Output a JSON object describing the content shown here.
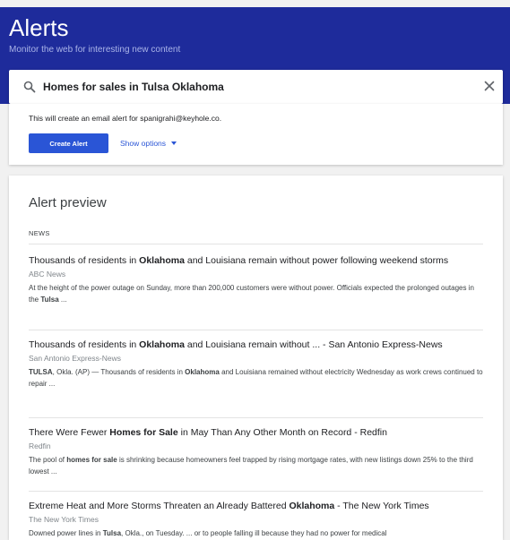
{
  "header": {
    "title": "Alerts",
    "subtitle": "Monitor the web for interesting new content"
  },
  "search": {
    "value": "Homes for sales in Tulsa Oklahoma",
    "icon": "search-icon",
    "clear_icon": "close-icon"
  },
  "create": {
    "note": "This will create an email alert for spanigrahi@keyhole.co.",
    "button_label": "Create Alert",
    "options_label": "Show options"
  },
  "preview": {
    "title": "Alert preview",
    "section_label": "NEWS",
    "items": [
      {
        "title_parts": [
          "Thousands of residents in ",
          "Oklahoma",
          " and Louisiana remain without power following weekend storms"
        ],
        "source": "ABC News",
        "snippet_parts": [
          "At the height of the power outage on Sunday, more than 200,000 customers were without power. Officials expected the prolonged outages in the ",
          "Tulsa",
          " ..."
        ]
      },
      {
        "title_parts": [
          "Thousands of residents in ",
          "Oklahoma",
          " and Louisiana remain without ... - San Antonio Express-News"
        ],
        "source": "San Antonio Express-News",
        "snippet_parts": [
          "TULSA",
          ", Okla. (AP) — Thousands of residents in ",
          "Oklahoma",
          " and Louisiana remained without electricity Wednesday as work crews continued to repair ..."
        ]
      },
      {
        "title_parts": [
          "There Were Fewer ",
          "Homes for Sale",
          " in May Than Any Other Month on Record - Redfin"
        ],
        "source": "Redfin",
        "snippet_parts": [
          "The pool of ",
          "homes for sale",
          " is shrinking because homeowners feel trapped by rising mortgage rates, with new listings down 25% to the third lowest ..."
        ]
      },
      {
        "title_parts": [
          "Extreme Heat and More Storms Threaten an Already Battered ",
          "Oklahoma",
          " - The New York Times"
        ],
        "source": "The New York Times",
        "snippet_parts": [
          "Downed power lines in ",
          "Tulsa",
          ", Okla., on Tuesday. ... or to people falling ill because they had no power for medical"
        ]
      }
    ]
  },
  "colors": {
    "header_bg": "#1e2b9b",
    "accent": "#2a55d6"
  }
}
